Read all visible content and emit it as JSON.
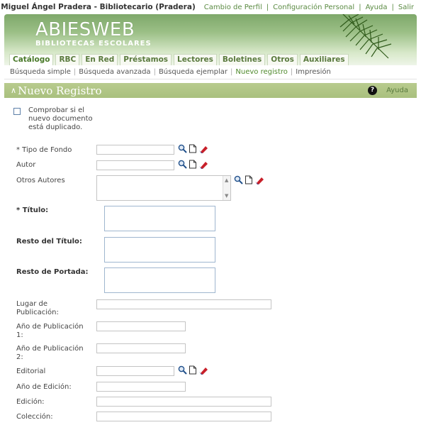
{
  "topbar": {
    "user": "Miguel Ángel Pradera - Bibliotecario (Pradera)",
    "links": [
      "Cambio de Perfil",
      "Configuración Personal",
      "Ayuda",
      "Salir"
    ]
  },
  "logo": {
    "name": "ABIESWEB",
    "subtitle": "BIBLIOTECAS ESCOLARES"
  },
  "tabs": [
    "Catálogo",
    "RBC",
    "En Red",
    "Préstamos",
    "Lectores",
    "Boletines",
    "Otros",
    "Auxiliares"
  ],
  "subnav": [
    "Búsqueda simple",
    "Búsqueda avanzada",
    "Búsqueda ejemplar",
    "Nuevo registro",
    "Impresión"
  ],
  "page": {
    "title": "Nuevo Registro",
    "help": "Ayuda"
  },
  "form": {
    "duplicate_check": "Comprobar si el nuevo documento está duplicado.",
    "tipo_fondo": "* Tipo de Fondo",
    "autor": "Autor",
    "otros_autores": "Otros Autores",
    "titulo": "* Título:",
    "resto_titulo": "Resto del Título:",
    "resto_portada": "Resto de Portada:",
    "lugar_publicacion": "Lugar de Publicación:",
    "anio_publicacion_1": "Año de Publicación 1:",
    "anio_publicacion_2": "Año de Publicación 2:",
    "editorial": "Editorial",
    "anio_edicion": "Año de Edición:",
    "edicion": "Edición:",
    "coleccion": "Colección:"
  },
  "colors": {
    "accent": "#5a8a42",
    "titlebar": "#aec283",
    "header_green": "#7ea86a"
  }
}
